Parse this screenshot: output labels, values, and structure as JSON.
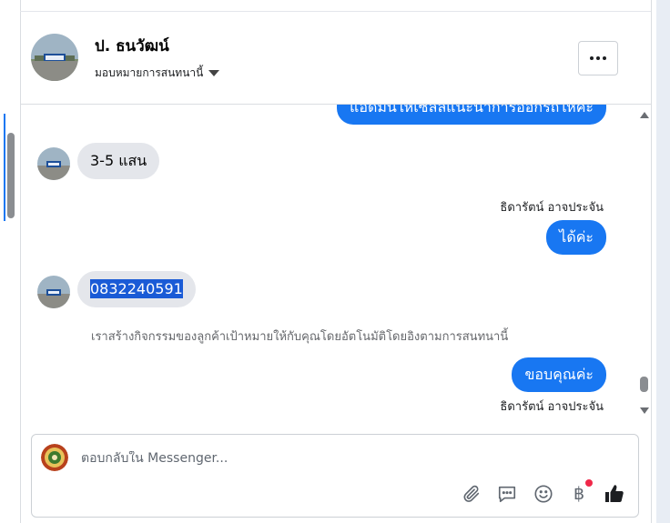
{
  "conversation": {
    "contact_name": "ป. ธนวัฒน์",
    "assignment_label": "มอบหมายการสนทนานี้"
  },
  "messages": [
    {
      "direction": "out",
      "text": "แอดมินให้เซลล์แนะนำการออกรถให้ค่ะ"
    },
    {
      "direction": "in",
      "text": "3-5 แสน"
    },
    {
      "direction": "out",
      "sender": "ธิดารัตน์ อาจประจัน",
      "text": "ได้ค่ะ"
    },
    {
      "direction": "in",
      "text": "0832240591",
      "selected": true
    },
    {
      "direction": "system",
      "text": "เราสร้างกิจกรรมของลูกค้าเป้าหมายให้กับคุณโดยอัตโนมัติโดยอิงตามการสนทนานี้"
    },
    {
      "direction": "out",
      "text": "ขอบคุณค่ะ"
    },
    {
      "direction": "out",
      "sender": "ธิดารัตน์ อาจประจัน",
      "text": ""
    }
  ],
  "composer": {
    "placeholder": "ตอบกลับใน Messenger...",
    "tools": [
      "paperclip-icon",
      "saved-reply-icon",
      "emoji-icon",
      "baht-payment-icon",
      "like-icon"
    ],
    "payment_glyph": "฿",
    "notification_dot_color": "#f02849"
  },
  "colors": {
    "outgoing_bubble": "#1877f2",
    "incoming_bubble": "#e4e6eb",
    "selection": "#1a5bd6"
  }
}
